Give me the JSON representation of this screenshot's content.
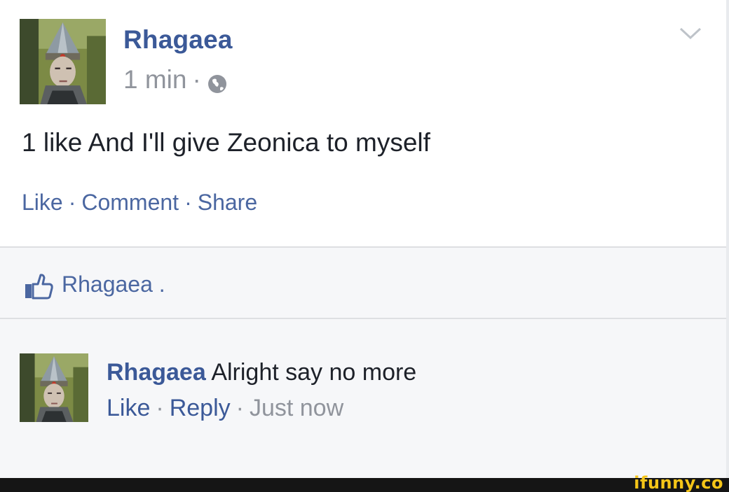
{
  "post": {
    "author": "Rhagaea",
    "time": "1 min",
    "time_separator": "·",
    "privacy_icon": "globe-icon",
    "menu_icon": "chevron-down-icon",
    "text": "1 like And I'll give Zeonica to myself",
    "actions": {
      "like": "Like",
      "comment": "Comment",
      "share": "Share",
      "separator": "·"
    }
  },
  "likes": {
    "icon": "thumbs-up-icon",
    "text": "Rhagaea ."
  },
  "comment": {
    "author": "Rhagaea",
    "text": "Alright say no more",
    "actions": {
      "like": "Like",
      "reply": "Reply",
      "time": "Just now",
      "separator": "·"
    }
  },
  "watermark": "ifunny.co",
  "colors": {
    "link_blue": "#3b5998",
    "action_blue": "#4b67a1",
    "meta_gray": "#90949c",
    "text_dark": "#1d2129",
    "background_light": "#f6f7f9",
    "watermark_yellow": "#f5c518"
  }
}
